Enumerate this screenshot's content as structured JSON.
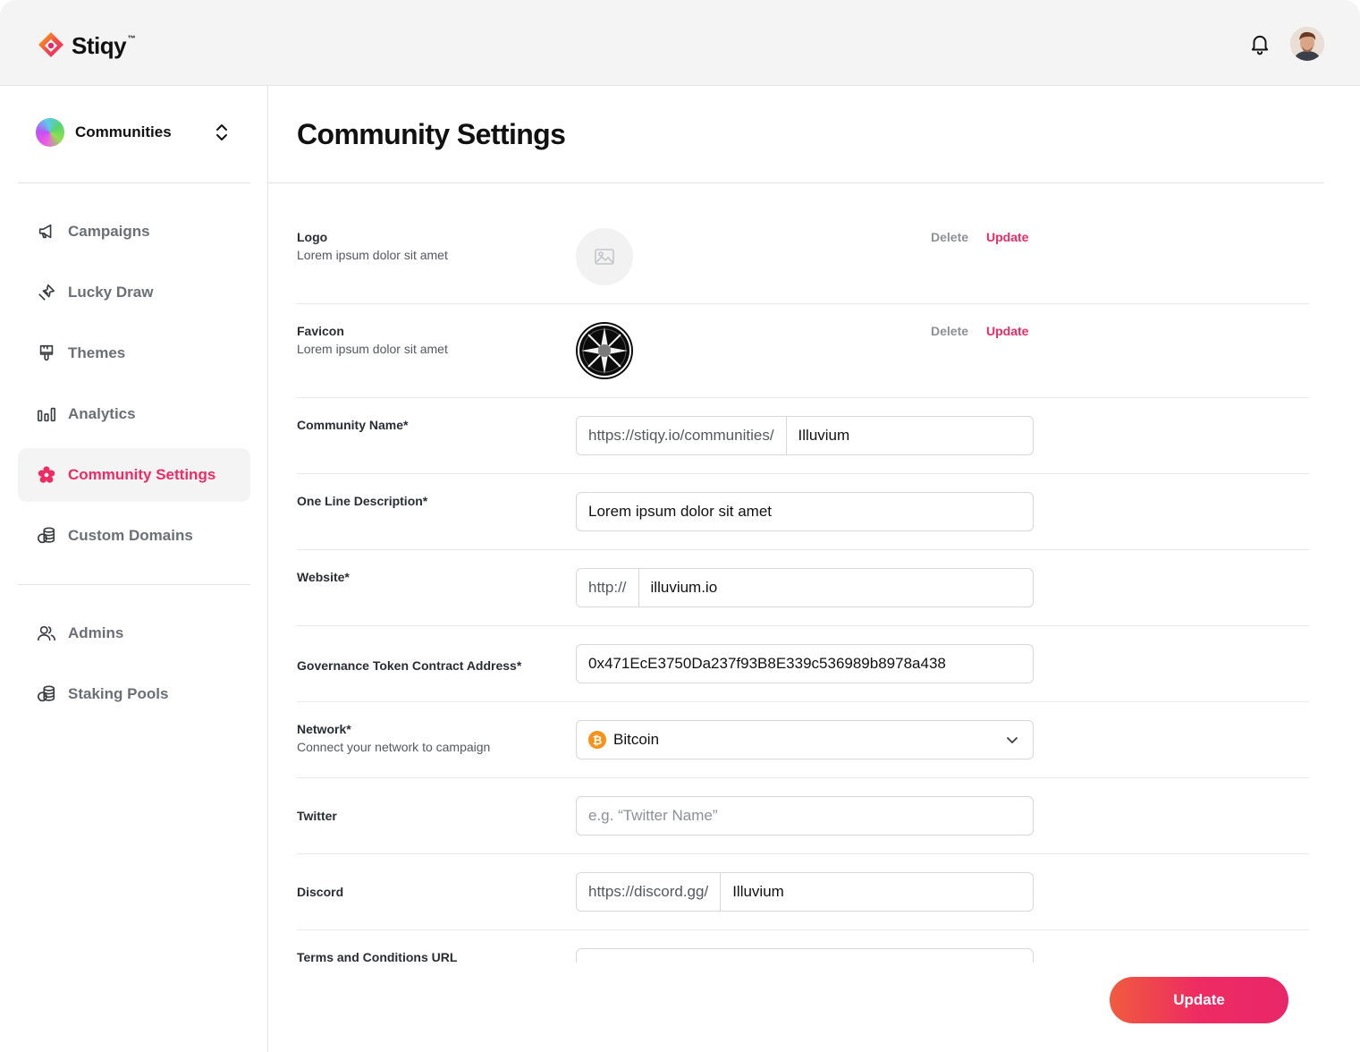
{
  "brand": {
    "name": "Stiqy",
    "tm": "™"
  },
  "header": {
    "notifications_icon": "bell-icon",
    "avatar": "user-avatar"
  },
  "sidebar": {
    "switcher": {
      "label": "Communities",
      "icon": "chevron-updown-icon"
    },
    "items": [
      {
        "label": "Campaigns",
        "icon": "megaphone-icon",
        "active": false
      },
      {
        "label": "Lucky Draw",
        "icon": "ticket-icon",
        "active": false
      },
      {
        "label": "Themes",
        "icon": "paintbrush-icon",
        "active": false
      },
      {
        "label": "Analytics",
        "icon": "bar-chart-icon",
        "active": false
      },
      {
        "label": "Community Settings",
        "icon": "settings-flower-icon",
        "active": true
      },
      {
        "label": "Custom Domains",
        "icon": "coins-stack-icon",
        "active": false
      },
      {
        "label": "Admins",
        "icon": "users-icon",
        "active": false
      },
      {
        "label": "Staking Pools",
        "icon": "coins-stack-icon",
        "active": false
      }
    ]
  },
  "main": {
    "title": "Community Settings",
    "logo": {
      "label": "Logo",
      "sub": "Lorem ipsum dolor sit amet",
      "delete": "Delete",
      "update": "Update"
    },
    "favicon": {
      "label": "Favicon",
      "sub": "Lorem ipsum dolor sit amet",
      "delete": "Delete",
      "update": "Update"
    },
    "community_name": {
      "label": "Community Name*",
      "prefix": "https://stiqy.io/communities/",
      "value": "Illuvium"
    },
    "description": {
      "label": "One Line Description*",
      "value": "Lorem ipsum dolor sit amet"
    },
    "website": {
      "label": "Website*",
      "prefix": "http://",
      "value": "illuvium.io"
    },
    "token": {
      "label": "Governance Token Contract Address*",
      "value": "0x471EcE3750Da237f93B8E339c536989b8978a438"
    },
    "network": {
      "label": "Network*",
      "sub": "Connect your network to campaign",
      "value": "Bitcoin",
      "coin_symbol": "₿"
    },
    "twitter": {
      "label": "Twitter",
      "placeholder": "e.g. “Twitter Name”"
    },
    "discord": {
      "label": "Discord",
      "prefix": "https://discord.gg/",
      "value": "Illuvium"
    },
    "terms": {
      "label": "Terms and Conditions URL"
    }
  },
  "footer": {
    "update_label": "Update"
  },
  "colors": {
    "accent": "#ee2b62",
    "muted": "#6b6f76",
    "bitcoin": "#f7931a"
  }
}
